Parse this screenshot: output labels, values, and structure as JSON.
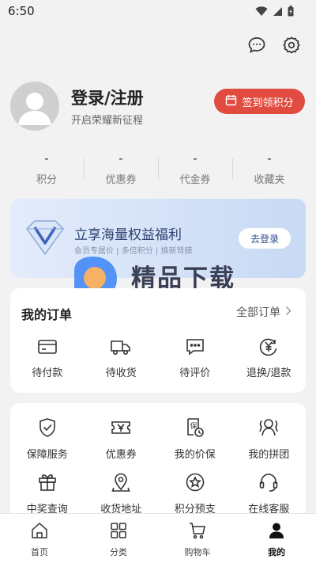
{
  "status_bar": {
    "time": "6:50"
  },
  "top_actions": {
    "message_icon": "chat-bubble-icon",
    "settings_icon": "gear-icon"
  },
  "profile": {
    "title": "登录/注册",
    "subtitle": "开启荣耀新征程"
  },
  "checkin": {
    "label": "签到领积分",
    "color": "#e24b3f"
  },
  "stats": [
    {
      "value": "-",
      "label": "积分"
    },
    {
      "value": "-",
      "label": "优惠券"
    },
    {
      "value": "-",
      "label": "代金券"
    },
    {
      "value": "-",
      "label": "收藏夹"
    }
  ],
  "banner": {
    "title": "立享海量权益福利",
    "subtitle": "会员专属价 | 多倍积分 | 焕新背膜",
    "button": "去登录"
  },
  "watermark": {
    "text": "精品下载",
    "url": "www.j9p.com"
  },
  "orders": {
    "title": "我的订单",
    "all_label": "全部订单",
    "items": [
      {
        "label": "待付款",
        "icon": "card-icon"
      },
      {
        "label": "待收货",
        "icon": "truck-icon"
      },
      {
        "label": "待评价",
        "icon": "comment-icon"
      },
      {
        "label": "退换/退款",
        "icon": "yen-refund-icon"
      }
    ]
  },
  "services": [
    {
      "label": "保障服务",
      "icon": "shield-check-icon"
    },
    {
      "label": "优惠券",
      "icon": "ticket-icon"
    },
    {
      "label": "我的价保",
      "icon": "price-protect-icon"
    },
    {
      "label": "我的拼团",
      "icon": "group-icon"
    },
    {
      "label": "中奖查询",
      "icon": "gift-icon"
    },
    {
      "label": "收货地址",
      "icon": "location-pin-icon"
    },
    {
      "label": "积分预支",
      "icon": "points-star-icon"
    },
    {
      "label": "在线客服",
      "icon": "headset-icon"
    }
  ],
  "tabbar": [
    {
      "label": "首页",
      "icon": "home-icon",
      "active": false
    },
    {
      "label": "分类",
      "icon": "grid-icon",
      "active": false
    },
    {
      "label": "购物车",
      "icon": "cart-icon",
      "active": false
    },
    {
      "label": "我的",
      "icon": "user-icon",
      "active": true
    }
  ]
}
